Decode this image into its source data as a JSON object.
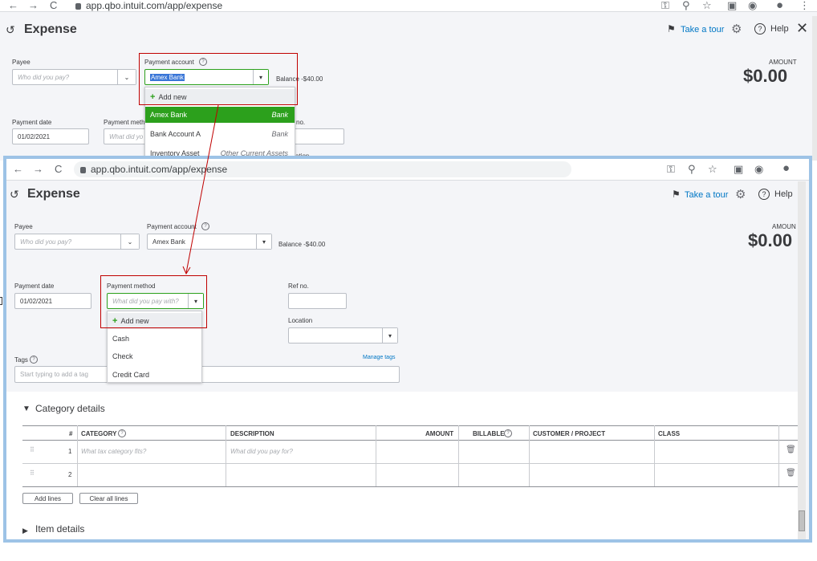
{
  "browser": {
    "back": "←",
    "forward": "→",
    "reload": "C",
    "url": "app.qbo.intuit.com/app/expense",
    "icons": [
      "key-icon",
      "zoom-icon",
      "star-icon",
      "extension-icon",
      "eye-icon",
      "profile-icon",
      "menu-icon"
    ]
  },
  "top": {
    "title": "Expense",
    "take_tour": "Take a tour",
    "help": "Help",
    "close": "✕",
    "payee_label": "Payee",
    "payee_placeholder": "Who did you pay?",
    "payment_account_label": "Payment account",
    "payment_account_value": "Amex Bank",
    "balance": "Balance -$40.00",
    "amount_label": "AMOUNT",
    "amount": "$0.00",
    "payment_date_label": "Payment date",
    "payment_date": "01/02/2021",
    "payment_method_label": "Payment meth",
    "payment_method_placeholder": "What did yo",
    "ref_label": "no.",
    "location_fragment": "ation",
    "account_menu": {
      "add_new": "Add new",
      "items": [
        {
          "name": "Amex Bank",
          "type": "Bank",
          "selected": true
        },
        {
          "name": "Bank Account A",
          "type": "Bank",
          "selected": false
        },
        {
          "name": "Inventory Asset",
          "type": "Other Current Assets",
          "selected": false
        }
      ]
    }
  },
  "bottom": {
    "url": "app.qbo.intuit.com/app/expense",
    "title": "Expense",
    "take_tour": "Take a tour",
    "help": "Help",
    "payee_label": "Payee",
    "payee_placeholder": "Who did you pay?",
    "payment_account_label": "Payment account",
    "payment_account_value": "Amex Bank",
    "balance": "Balance -$40.00",
    "amount_label": "AMOUN",
    "amount": "$0.00",
    "payment_date_label": "Payment date",
    "payment_date": "01/02/2021",
    "payment_method_label": "Payment method",
    "payment_method_placeholder": "What did you pay with?",
    "ref_label": "Ref no.",
    "location_label": "Location",
    "tags_label": "Tags",
    "tags_placeholder": "Start typing to add a tag",
    "manage_tags": "Manage tags",
    "method_menu": {
      "add_new": "Add new",
      "items": [
        "Cash",
        "Check",
        "Credit Card"
      ]
    },
    "category_details": "Category details",
    "columns": [
      "#",
      "CATEGORY",
      "DESCRIPTION",
      "AMOUNT",
      "BILLABLE",
      "CUSTOMER / PROJECT",
      "CLASS"
    ],
    "rows": [
      {
        "num": "1",
        "category": "What tax category fits?",
        "description": "What did you pay for?"
      },
      {
        "num": "2",
        "category": "",
        "description": ""
      }
    ],
    "add_lines": "Add lines",
    "clear_all_lines": "Clear all lines",
    "item_details": "Item details"
  },
  "colors": {
    "selected_green": "#2ca01c",
    "link_blue": "#0077c5",
    "highlight_red": "#c00000",
    "frame_blue": "#9dc3e6"
  }
}
